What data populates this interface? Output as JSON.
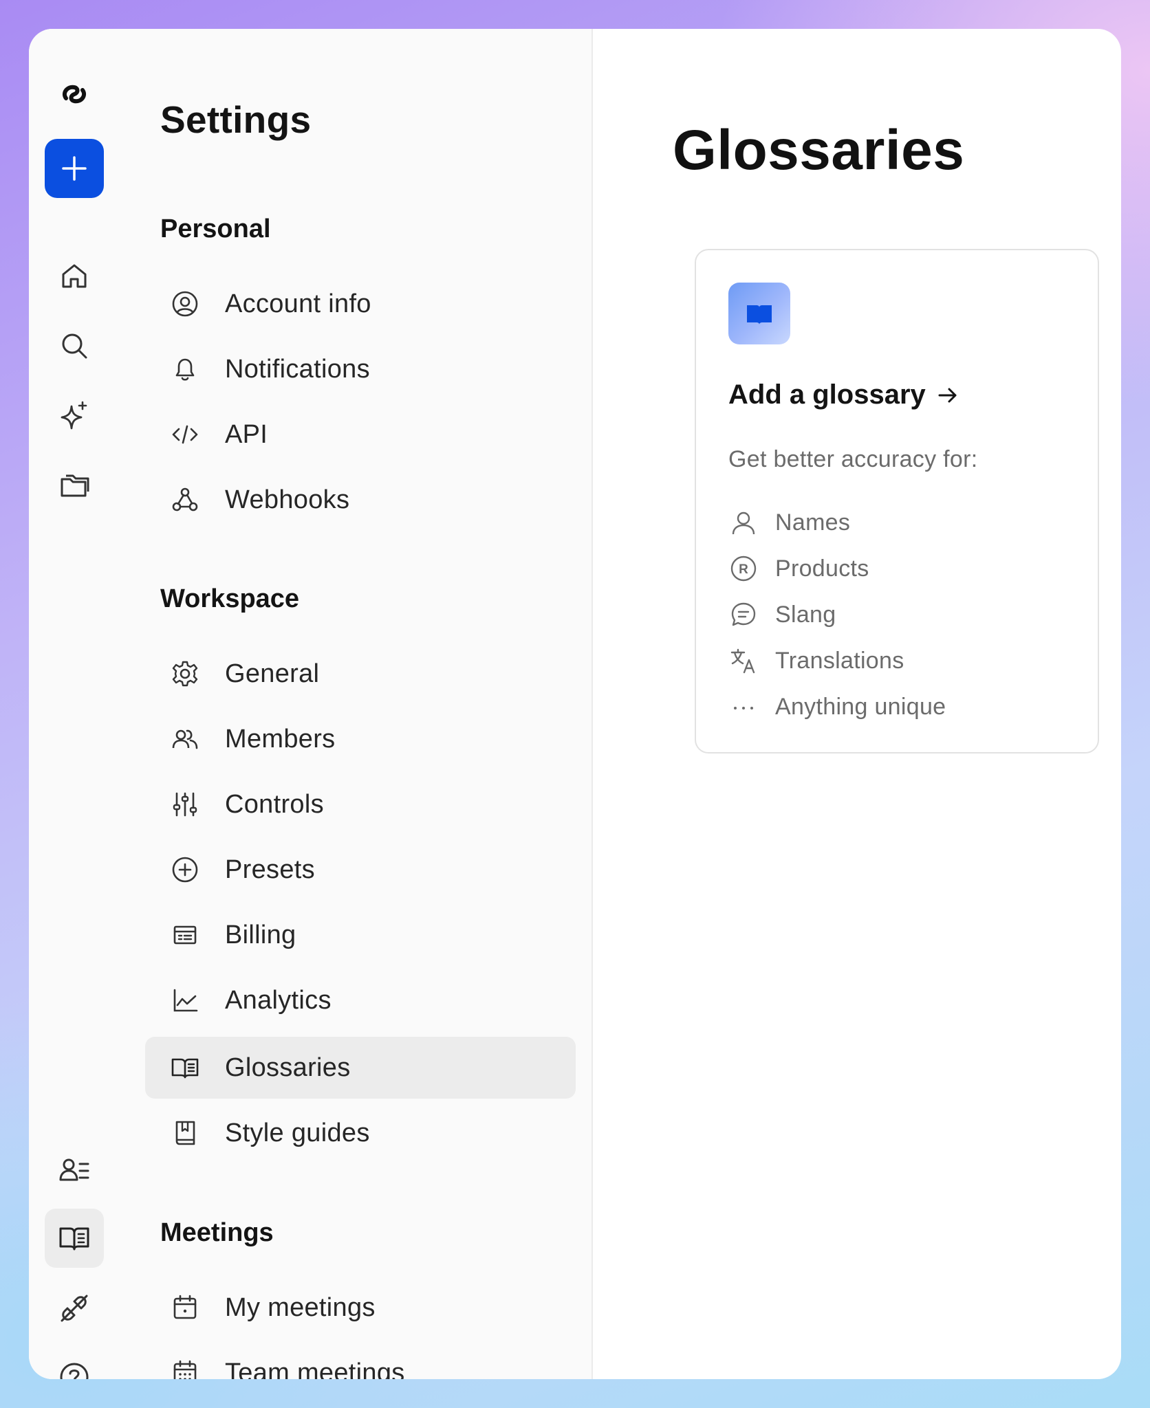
{
  "nav": {
    "title": "Settings",
    "sections": {
      "personal": "Personal",
      "workspace": "Workspace",
      "meetings": "Meetings"
    },
    "items": {
      "account_info": "Account info",
      "notifications": "Notifications",
      "api": "API",
      "webhooks": "Webhooks",
      "general": "General",
      "members": "Members",
      "controls": "Controls",
      "presets": "Presets",
      "billing": "Billing",
      "analytics": "Analytics",
      "glossaries": "Glossaries",
      "style_guides": "Style guides",
      "my_meetings": "My meetings",
      "team_meetings": "Team meetings"
    },
    "active_item": "glossaries"
  },
  "rail": {
    "icons": [
      "logo-icon",
      "plus-icon",
      "home-icon",
      "search-icon",
      "sparkle-icon",
      "folders-icon",
      "contacts-icon",
      "glossary-book-icon",
      "unplug-icon",
      "help-icon"
    ],
    "active": "glossary-book-icon"
  },
  "main": {
    "title": "Glossaries",
    "card": {
      "heading": "Add a glossary",
      "subtitle": "Get better accuracy for:",
      "features": {
        "names": "Names",
        "products": "Products",
        "slang": "Slang",
        "translations": "Translations",
        "anything_unique": "Anything unique"
      }
    }
  },
  "colors": {
    "primary": "#0b4fe0",
    "active_bg": "#ececec",
    "text": "#141414",
    "muted": "#6b6b6b"
  }
}
